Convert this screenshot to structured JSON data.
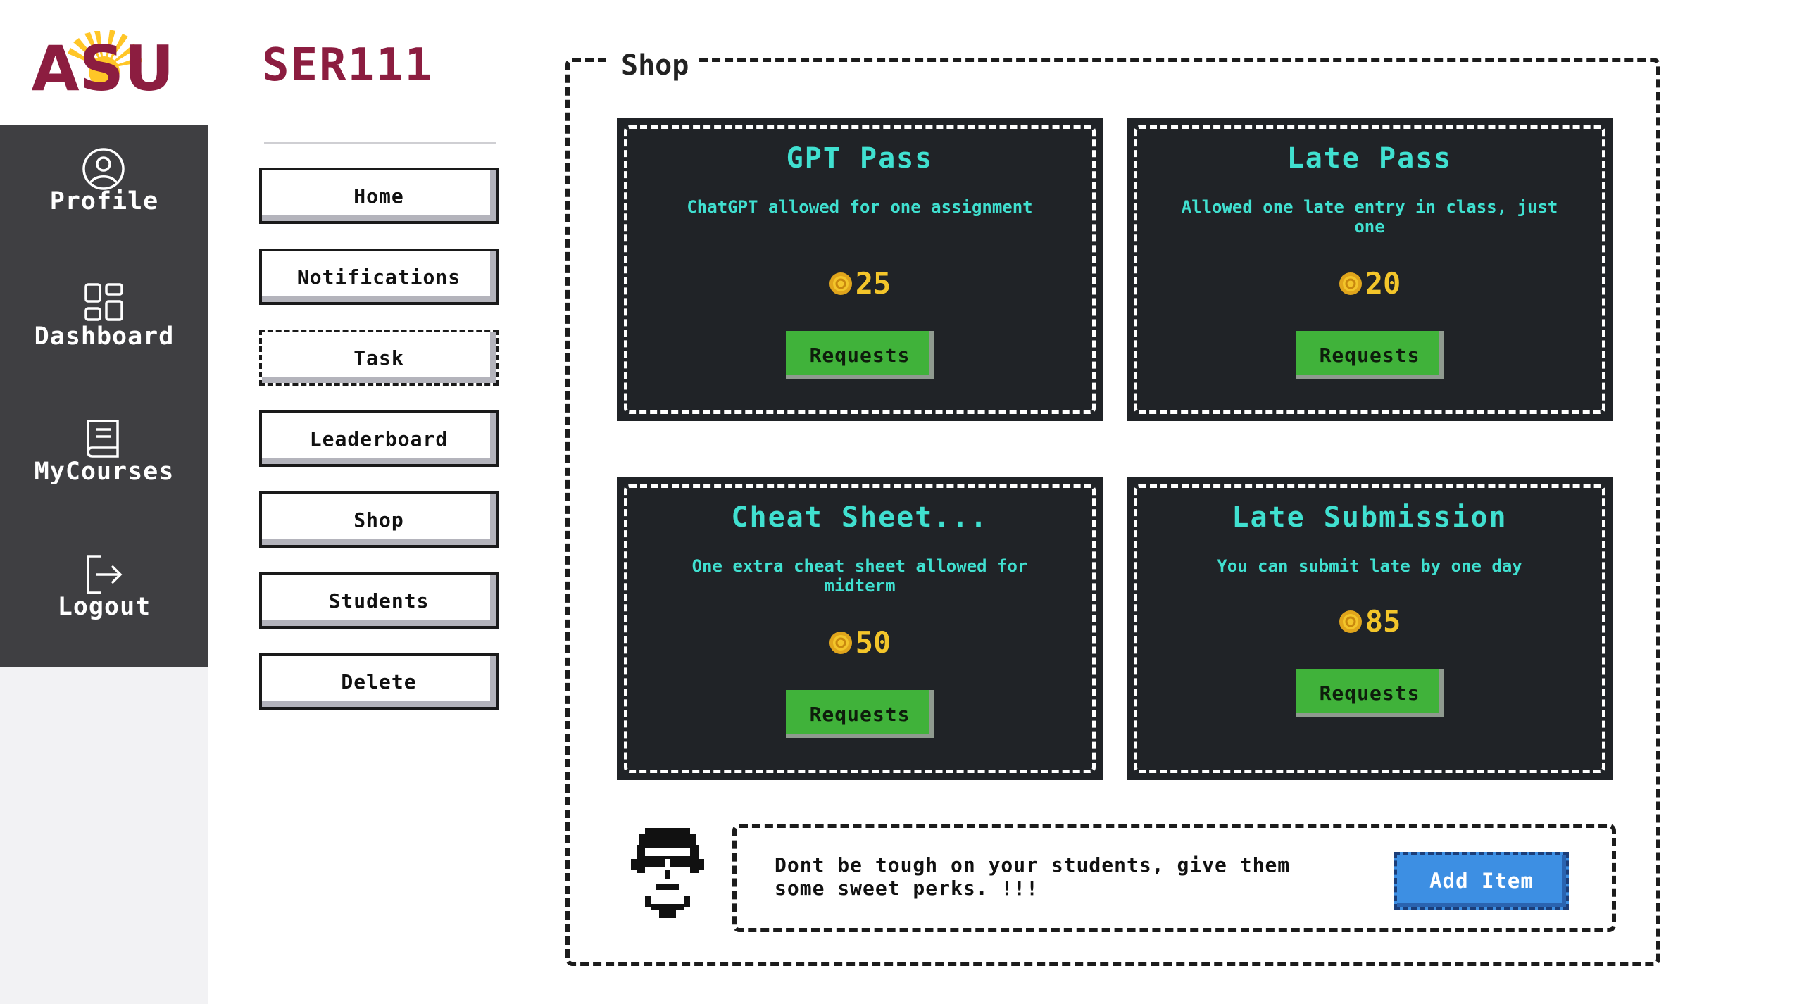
{
  "brand": {
    "logo_text": "ASU",
    "course_title": "SER111"
  },
  "sidebar": {
    "items": [
      {
        "label": "Profile",
        "icon": "user-circle-icon"
      },
      {
        "label": "Dashboard",
        "icon": "grid-icon"
      },
      {
        "label": "MyCourses",
        "icon": "book-icon"
      },
      {
        "label": "Logout",
        "icon": "logout-icon"
      }
    ]
  },
  "nav": {
    "items": [
      {
        "label": "Home"
      },
      {
        "label": "Notifications"
      },
      {
        "label": "Task"
      },
      {
        "label": "Leaderboard"
      },
      {
        "label": "Shop"
      },
      {
        "label": "Students"
      },
      {
        "label": "Delete"
      }
    ]
  },
  "shop": {
    "title": "Shop",
    "items": [
      {
        "title": "GPT Pass",
        "description": "ChatGPT allowed for one assignment",
        "price": "25",
        "button": "Requests"
      },
      {
        "title": "Late Pass",
        "description": "Allowed one late entry in class, just one",
        "price": "20",
        "button": "Requests"
      },
      {
        "title": "Cheat Sheet...",
        "description": "One extra cheat sheet allowed for midterm",
        "price": "50",
        "button": "Requests"
      },
      {
        "title": "Late Submission",
        "description": "You can submit late by one day",
        "price": "85",
        "button": "Requests"
      }
    ],
    "message": "Dont be tough on your students, give them some sweet perks. !!!",
    "add_button": "Add Item"
  },
  "colors": {
    "brand_maroon": "#8c1d40",
    "brand_gold": "#ffc627",
    "sidebar_bg": "#3f3f42",
    "card_bg": "#202327",
    "card_text": "#40e0d0",
    "price": "#f3c52a",
    "request_button": "#40b23a",
    "add_button": "#3d8fe3"
  }
}
